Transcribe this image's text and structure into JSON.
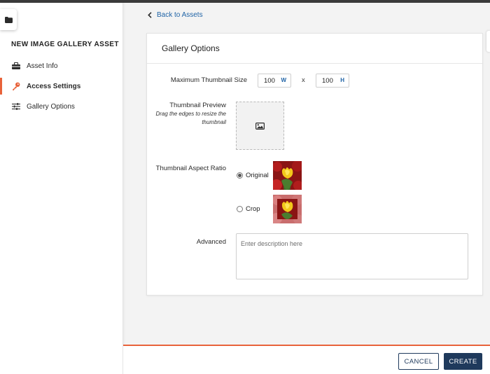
{
  "sidebar": {
    "title": "NEW IMAGE GALLERY ASSET",
    "items": [
      {
        "label": "Asset Info",
        "icon": "toolbox-icon",
        "active": false
      },
      {
        "label": "Access Settings",
        "icon": "key-icon",
        "active": true
      },
      {
        "label": "Gallery Options",
        "icon": "sliders-icon",
        "active": false
      }
    ]
  },
  "back_link": {
    "label": "Back to Assets"
  },
  "card": {
    "title": "Gallery Options",
    "max_size": {
      "label": "Maximum Thumbnail Size",
      "width": "100",
      "width_unit": "W",
      "separator": "x",
      "height": "100",
      "height_unit": "H"
    },
    "preview": {
      "label": "Thumbnail Preview",
      "hint": "Drag the edges to resize the thumbnail"
    },
    "aspect": {
      "label": "Thumbnail Aspect Ratio",
      "options": [
        {
          "label": "Original",
          "checked": true
        },
        {
          "label": "Crop",
          "checked": false
        }
      ]
    },
    "advanced": {
      "label": "Advanced",
      "placeholder": "Enter description here"
    }
  },
  "footer": {
    "cancel_label": "CANCEL",
    "create_label": "CREATE"
  },
  "colors": {
    "accent": "#e8623a",
    "primary": "#1f3a5c",
    "link": "#1f63a6"
  }
}
